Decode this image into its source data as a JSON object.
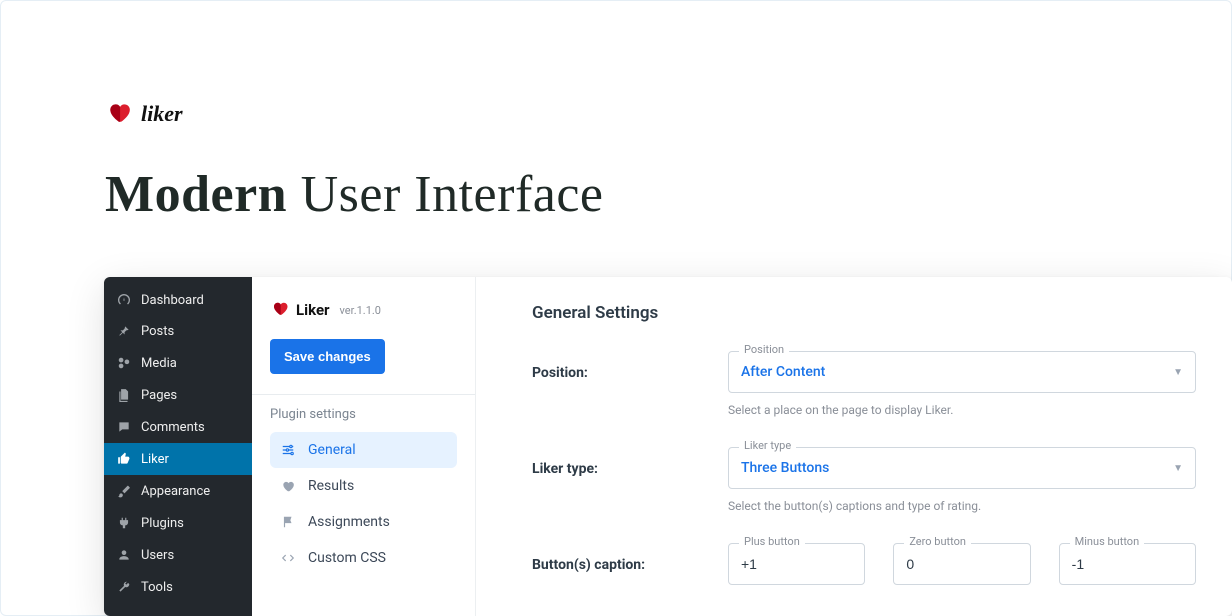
{
  "brand": {
    "name": "liker"
  },
  "hero": {
    "bold": "Modern",
    "light": "User Interface"
  },
  "sidebar": {
    "items": [
      {
        "label": "Dashboard",
        "icon": "gauge-icon"
      },
      {
        "label": "Posts",
        "icon": "pin-icon"
      },
      {
        "label": "Media",
        "icon": "media-icon"
      },
      {
        "label": "Pages",
        "icon": "pages-icon"
      },
      {
        "label": "Comments",
        "icon": "comment-icon"
      },
      {
        "label": "Liker",
        "icon": "thumb-icon"
      },
      {
        "label": "Appearance",
        "icon": "brush-icon"
      },
      {
        "label": "Plugins",
        "icon": "plug-icon"
      },
      {
        "label": "Users",
        "icon": "user-icon"
      },
      {
        "label": "Tools",
        "icon": "wrench-icon"
      }
    ]
  },
  "panelLeft": {
    "title": "Liker",
    "version": "ver.1.1.0",
    "saveLabel": "Save changes",
    "group": "Plugin settings",
    "items": [
      {
        "label": "General"
      },
      {
        "label": "Results"
      },
      {
        "label": "Assignments"
      },
      {
        "label": "Custom CSS"
      }
    ]
  },
  "main": {
    "title": "General Settings",
    "position": {
      "label": "Position:",
      "floatLabel": "Position",
      "value": "After Content",
      "helper": "Select a place on the page to display Liker."
    },
    "likerType": {
      "label": "Liker type:",
      "floatLabel": "Liker type",
      "value": "Three Buttons",
      "helper": "Select the button(s) captions and type of rating."
    },
    "captions": {
      "label": "Button(s) caption:",
      "plus": {
        "floatLabel": "Plus button",
        "value": "+1"
      },
      "zero": {
        "floatLabel": "Zero button",
        "value": "0"
      },
      "minus": {
        "floatLabel": "Minus button",
        "value": "-1"
      }
    }
  }
}
